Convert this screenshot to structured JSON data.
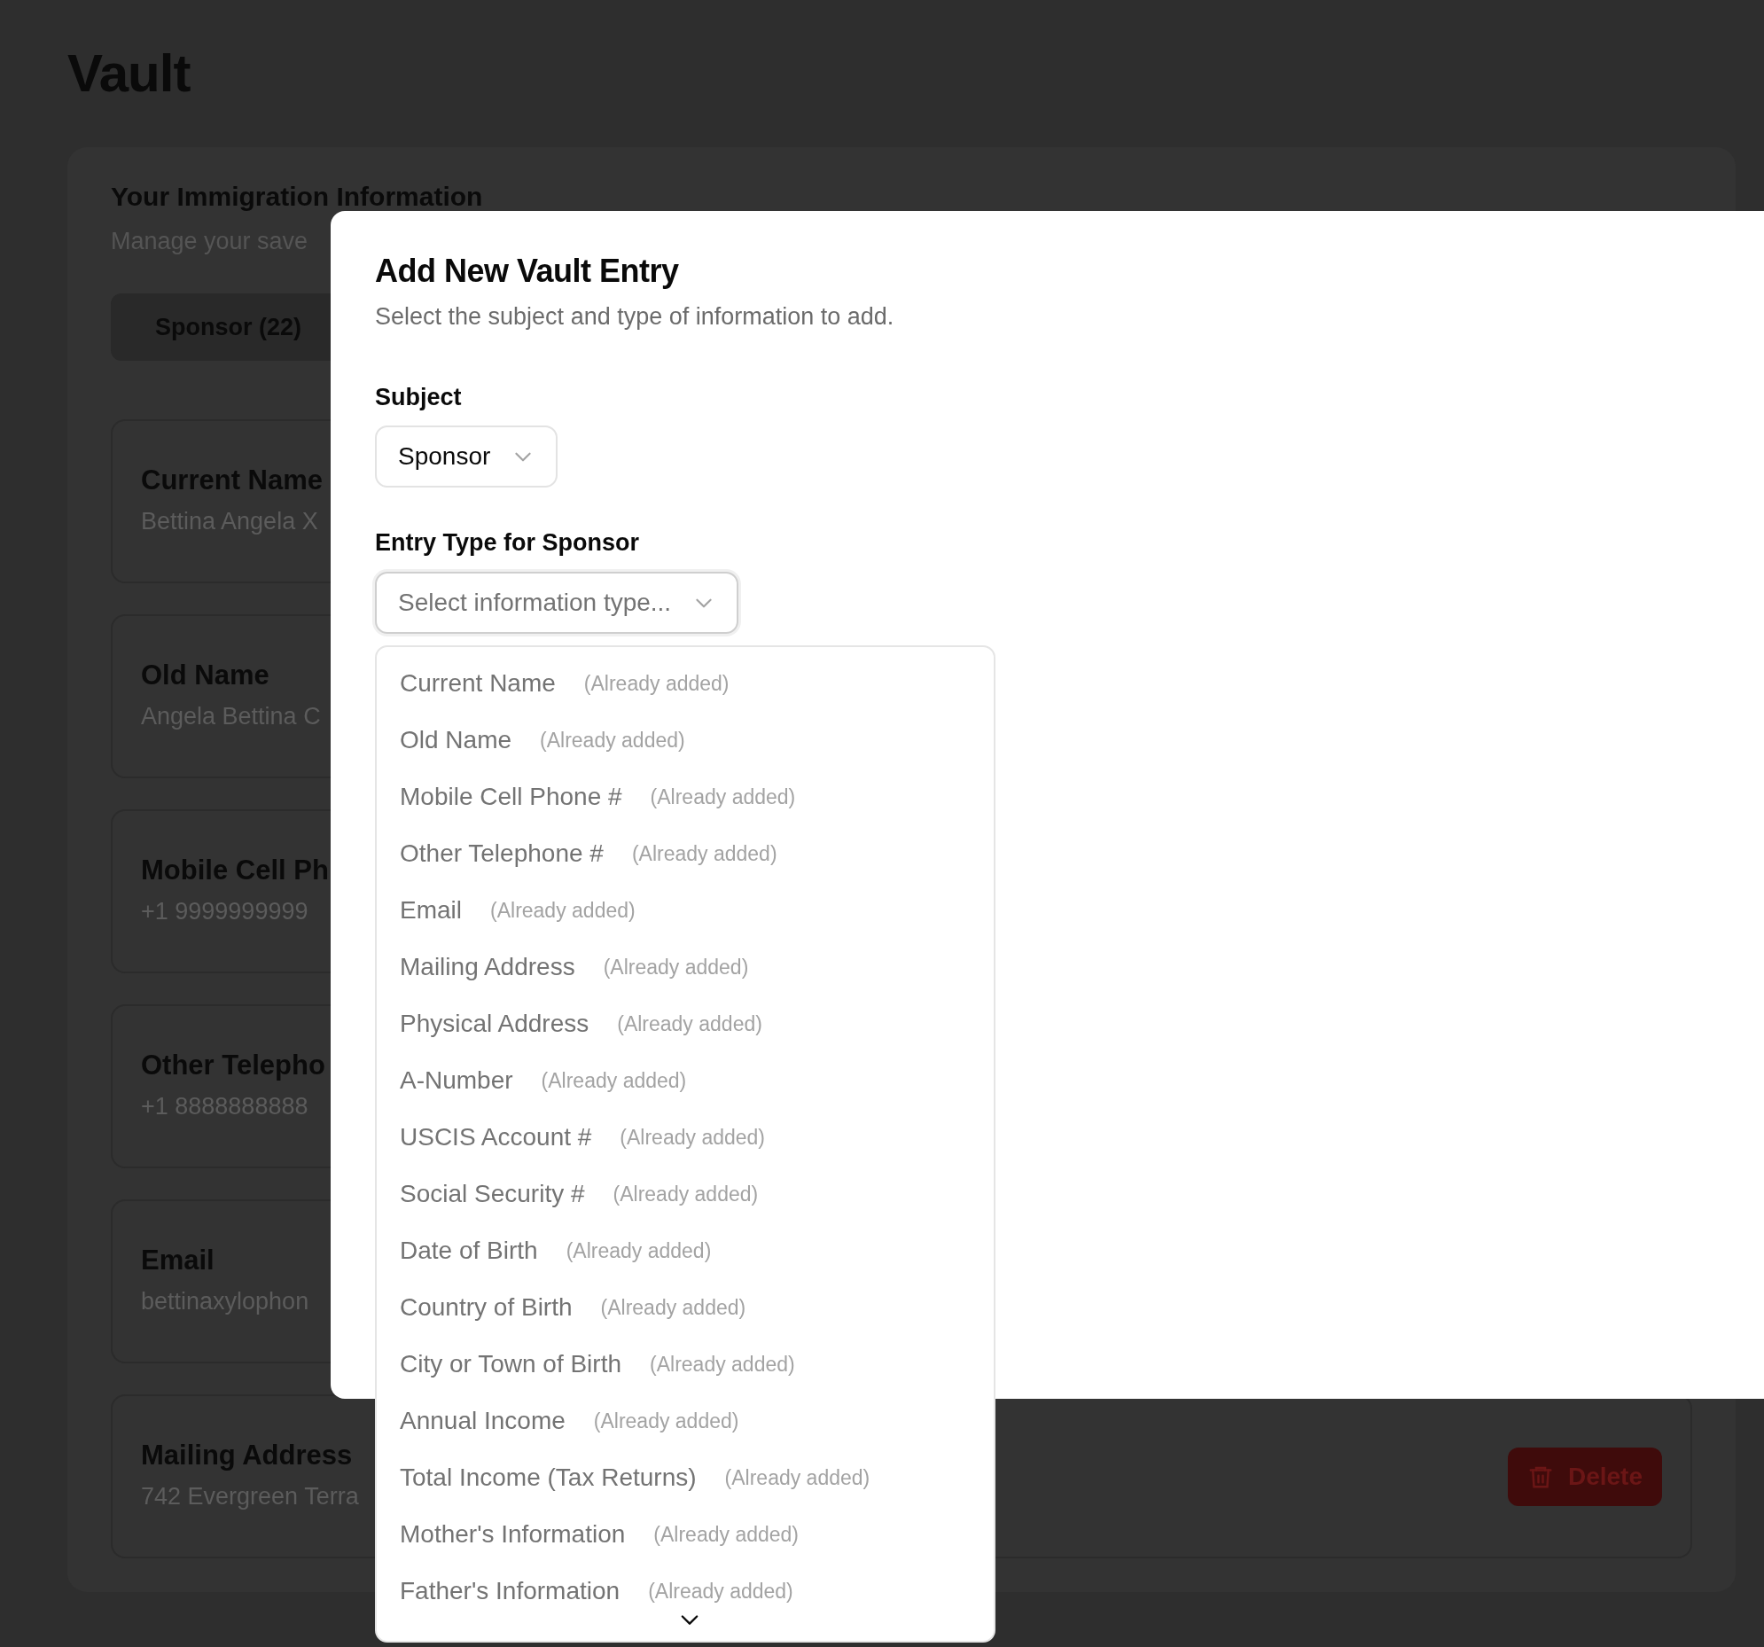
{
  "page_title": "Vault",
  "panel": {
    "title": "Your Immigration Information",
    "subtitle": "Manage your save"
  },
  "tabs": [
    {
      "label": "Sponsor (22)",
      "selected": true
    }
  ],
  "entries": [
    {
      "title": "Current Name",
      "value": "Bettina Angela X"
    },
    {
      "title": "Old Name",
      "value": "Angela Bettina C"
    },
    {
      "title": "Mobile Cell Ph",
      "value": "+1 9999999999"
    },
    {
      "title": "Other Telepho",
      "value": "+1 8888888888"
    },
    {
      "title": "Email",
      "value": "bettinaxylophon"
    },
    {
      "title": "Mailing Address",
      "value": "742 Evergreen Terra",
      "action": "Delete"
    }
  ],
  "dialog": {
    "title": "Add New Vault Entry",
    "description": "Select the subject and type of information to add.",
    "subject": {
      "label": "Subject",
      "value": "Sponsor"
    },
    "entry_type": {
      "label": "Entry Type for Sponsor",
      "placeholder": "Select information type...",
      "expanded": true
    },
    "options": [
      {
        "label": "Current Name",
        "note": "(Already added)",
        "disabled": true
      },
      {
        "label": "Old Name",
        "note": "(Already added)",
        "disabled": true
      },
      {
        "label": "Mobile Cell Phone #",
        "note": "(Already added)",
        "disabled": true
      },
      {
        "label": "Other Telephone #",
        "note": "(Already added)",
        "disabled": true
      },
      {
        "label": "Email",
        "note": "(Already added)",
        "disabled": true
      },
      {
        "label": "Mailing Address",
        "note": "(Already added)",
        "disabled": true
      },
      {
        "label": "Physical Address",
        "note": "(Already added)",
        "disabled": true
      },
      {
        "label": "A-Number",
        "note": "(Already added)",
        "disabled": true
      },
      {
        "label": "USCIS Account #",
        "note": "(Already added)",
        "disabled": true
      },
      {
        "label": "Social Security #",
        "note": "(Already added)",
        "disabled": true
      },
      {
        "label": "Date of Birth",
        "note": "(Already added)",
        "disabled": true
      },
      {
        "label": "Country of Birth",
        "note": "(Already added)",
        "disabled": true
      },
      {
        "label": "City or Town of Birth",
        "note": "(Already added)",
        "disabled": true
      },
      {
        "label": "Annual Income",
        "note": "(Already added)",
        "disabled": true
      },
      {
        "label": "Total Income (Tax Returns)",
        "note": "(Already added)",
        "disabled": true
      },
      {
        "label": "Mother's Information",
        "note": "(Already added)",
        "disabled": true
      },
      {
        "label": "Father's Information",
        "note": "(Already added)",
        "disabled": true
      }
    ]
  }
}
